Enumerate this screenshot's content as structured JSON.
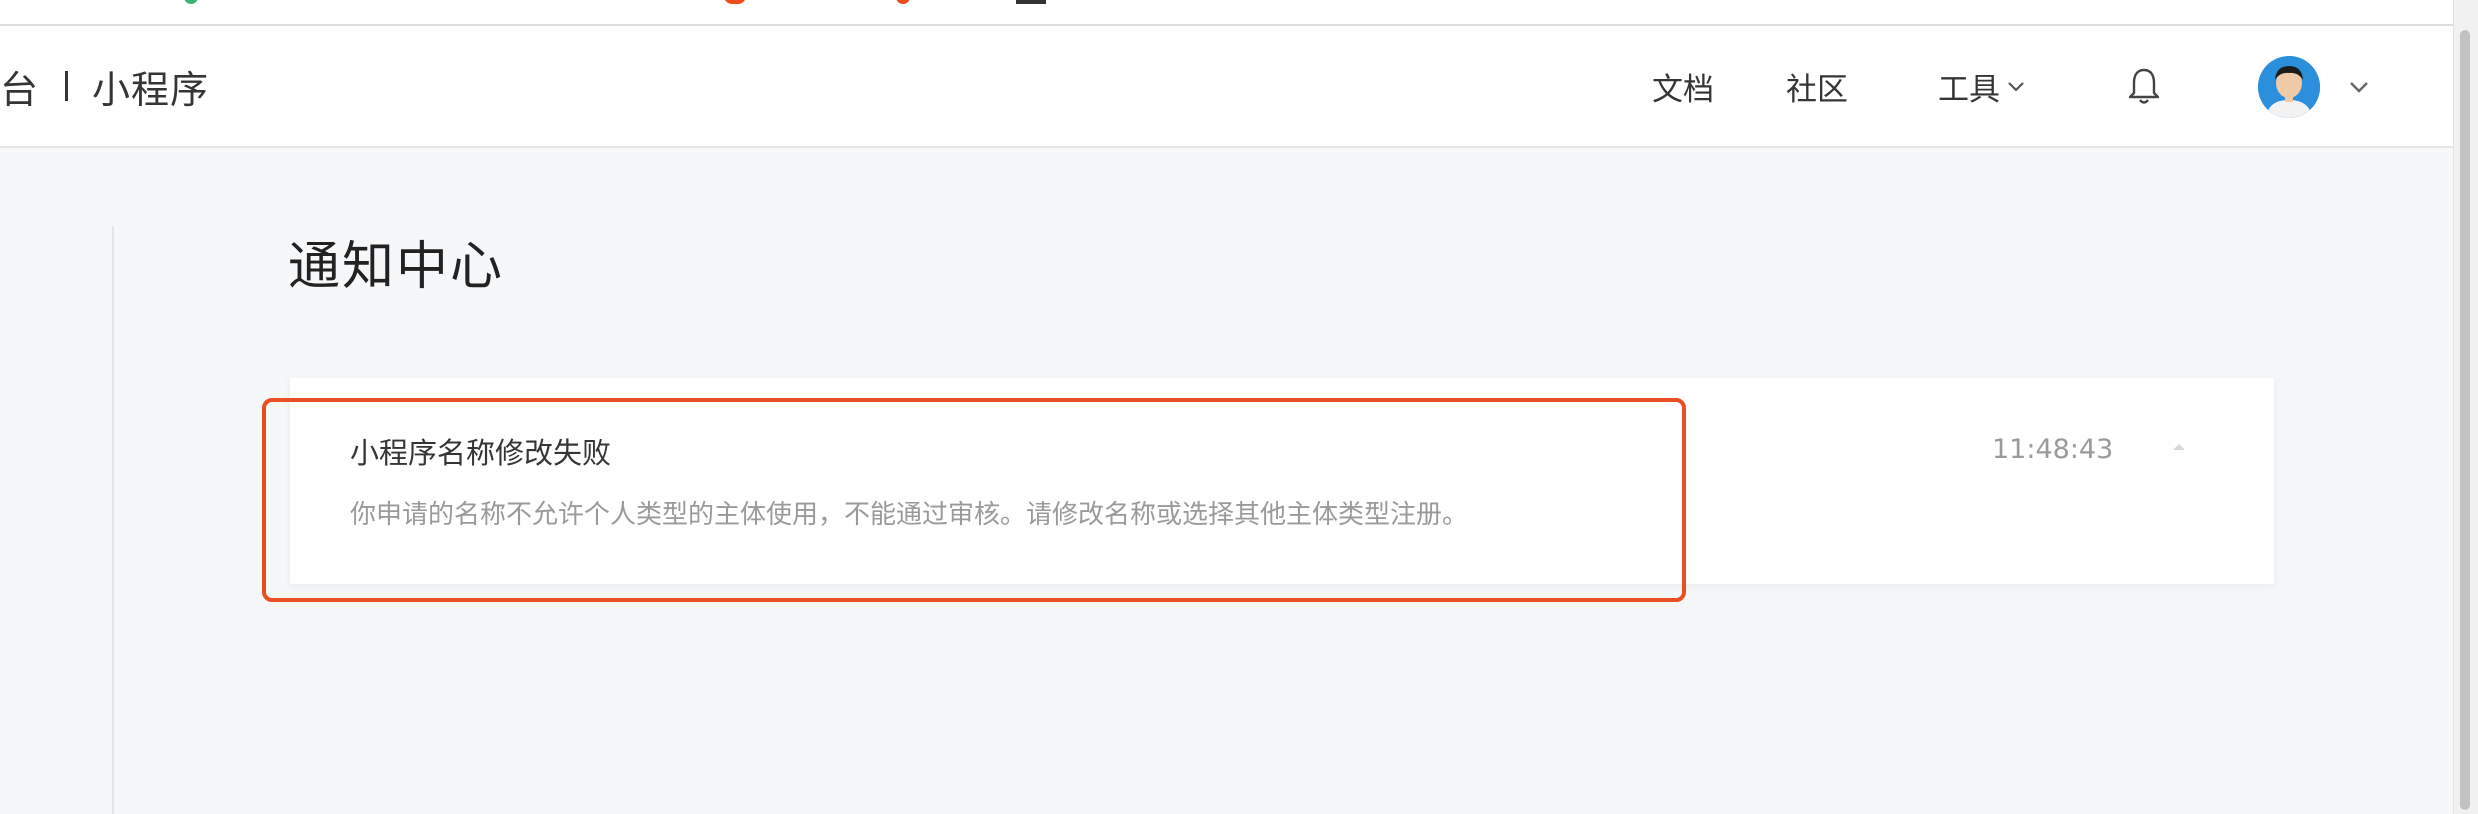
{
  "header": {
    "brand_prefix": "台",
    "brand_name": "小程序",
    "nav": {
      "docs": "文档",
      "community": "社区",
      "tools": "工具"
    }
  },
  "icons": {
    "bell": "bell-icon",
    "avatar": "avatar",
    "tools_chevron": "chevron-down-icon",
    "account_chevron": "chevron-down-icon",
    "collapse": "chevron-up-icon"
  },
  "page": {
    "title": "通知中心"
  },
  "notifications": [
    {
      "title": "小程序名称修改失败",
      "description": "你申请的名称不允许个人类型的主体使用，不能通过审核。请修改名称或选择其他主体类型注册。",
      "time": "11:48:43"
    }
  ],
  "colors": {
    "highlight": "#ea4e23",
    "background": "#f6f7f9",
    "card": "#ffffff",
    "text_primary": "#353535",
    "text_secondary": "#9a9a9a"
  }
}
